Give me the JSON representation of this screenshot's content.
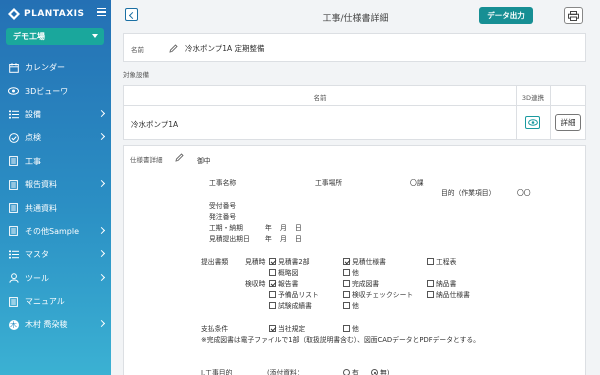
{
  "brand": {
    "name": "PLANTAXIS"
  },
  "sidebar": {
    "factory": "デモ工場",
    "items": [
      {
        "label": "カレンダー"
      },
      {
        "label": "3Dビューワ"
      },
      {
        "label": "設備"
      },
      {
        "label": "点検"
      },
      {
        "label": "工事"
      },
      {
        "label": "報告資料"
      },
      {
        "label": "共通資料"
      },
      {
        "label": "その他Sample"
      },
      {
        "label": "マスタ"
      },
      {
        "label": "ツール"
      },
      {
        "label": "マニュアル"
      },
      {
        "label": "木村 喬朶稜"
      }
    ],
    "avatar_letter": "木"
  },
  "header": {
    "title": "工事/仕様書詳細",
    "export_label": "データ出力"
  },
  "name_card": {
    "label": "名前",
    "value": "冷水ポンプ1A 定期整備"
  },
  "equipment": {
    "section_label": "対象設備",
    "col_name": "名前",
    "col_3d": "3D連携",
    "rows": [
      {
        "name": "冷水ポンプ1A",
        "detail_label": "詳細"
      }
    ]
  },
  "spec": {
    "label": "仕様書詳細",
    "greeting": "御中",
    "work_name": "工事名称",
    "work_place": "工事場所",
    "ryo": "〇課",
    "purpose": "目的（作業項目）",
    "purpose_val": "〇〇",
    "received_no": "受付番号",
    "order_no": "発注番号",
    "period": "工期・納期",
    "quote_due": "見積提出期日",
    "year": "年",
    "month": "月",
    "day": "日",
    "submit_docs": "提出書類",
    "at_quote": "見積時",
    "at_inspect": "検収時",
    "opt_quote2": "見積書2部",
    "opt_quote_spec": "見積仕様書",
    "opt_schedule": "工程表",
    "opt_outline": "概略図",
    "opt_other": "他",
    "opt_report": "報告書",
    "opt_complete_drawing": "完成図書",
    "opt_delivery_doc": "納品書",
    "opt_parts_list": "予備品リスト",
    "opt_checksheet": "検収チェックシート",
    "opt_delivery_spec": "納品仕様書",
    "opt_test_report": "試験成績書",
    "pay_terms": "支払条件",
    "pay_company": "当社規定",
    "note": "※完成図書は電子ファイルで1部（取扱説明書含む）、図面CADデータとPDFデータとする。",
    "section1": "Ⅰ.工事目的",
    "attach": "(添付資料：",
    "yes": "有",
    "no": "無)"
  }
}
